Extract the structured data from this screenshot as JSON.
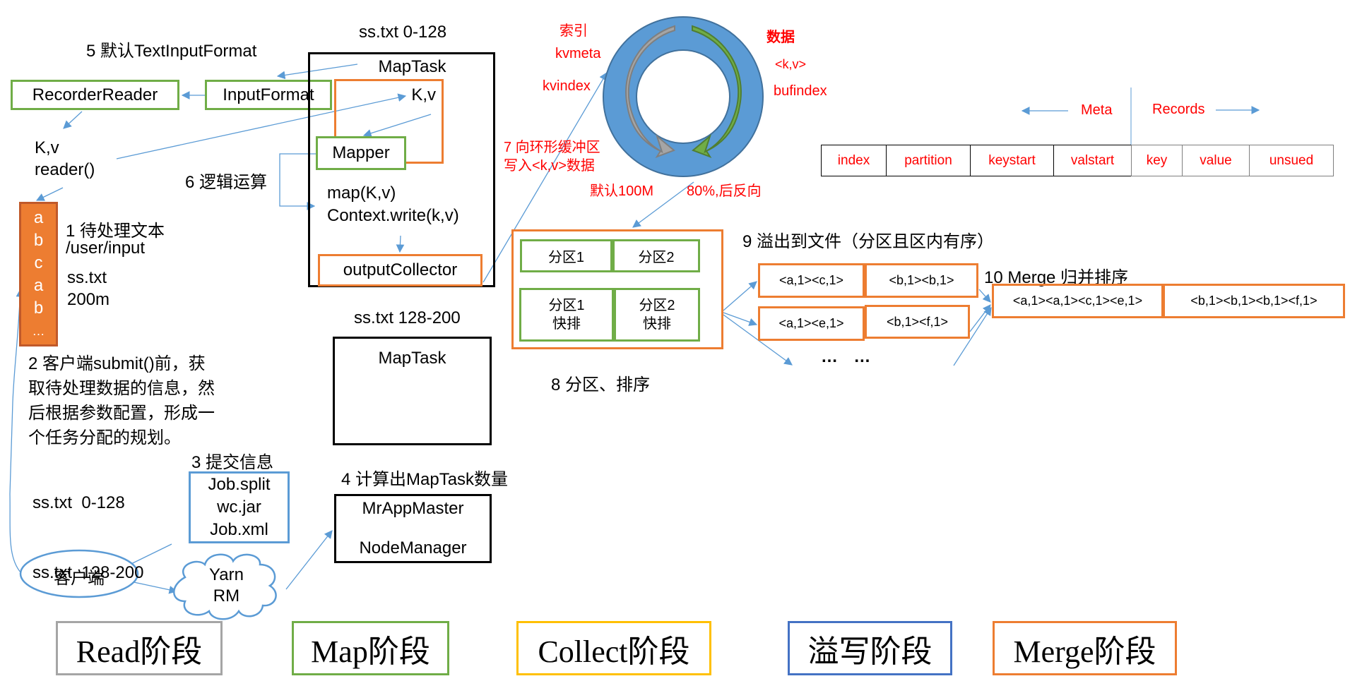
{
  "steps": {
    "s1_title": "1 待处理文本",
    "s1_path": "/user/input",
    "s1_file": "ss.txt",
    "s1_size": "200m",
    "s2_lines": [
      "2 客户端submit()前，获",
      "取待处理数据的信息，然",
      "后根据参数配置，形成一",
      "个任务分配的规划。"
    ],
    "s2_splits": [
      "ss.txt  0-128",
      "ss.txt  128-200"
    ],
    "s3_title": "3 提交信息",
    "s3_files": [
      "Job.split",
      "wc.jar",
      "Job.xml"
    ],
    "s4_title": "4 计算出MapTask数量",
    "s5_title": "5 默认TextInputFormat",
    "s6_title": "6 逻辑运算",
    "s7_lines": [
      "7 向环形缓冲区",
      "写入<k,v>数据"
    ],
    "s8_title": "8 分区、排序",
    "s9_title": "9 溢出到文件（分区且区内有序）",
    "s10_title": "10 Merge 归并排序"
  },
  "read": {
    "recorder_reader": "RecorderReader",
    "input_format": "InputFormat",
    "kv": "K,v",
    "reader_call": "reader()",
    "input_column": [
      "a",
      "b",
      "c",
      "a",
      "b",
      "…"
    ]
  },
  "maptask1": {
    "split_label": "ss.txt 0-128",
    "title": "MapTask",
    "kv": "K,v",
    "mapper": "Mapper",
    "map_call": "map(K,v)",
    "context_write": "Context.write(k,v)",
    "output_collector": "outputCollector"
  },
  "maptask2": {
    "split_label": "ss.txt 128-200",
    "title": "MapTask"
  },
  "cluster": {
    "app_master": "MrAppMaster",
    "node_manager": "NodeManager",
    "client": "客户端",
    "yarn_line1": "Yarn",
    "yarn_line2": "RM"
  },
  "ring_buffer": {
    "index_label": "索引",
    "kvmeta": "kvmeta",
    "kvindex": "kvindex",
    "data_label": "数据",
    "kv": "<k,v>",
    "bufindex": "bufindex",
    "default_size": "默认100M",
    "threshold": "80%,后反向",
    "threshold_fraction": 0.8,
    "meta_label": "Meta",
    "records_label": "Records",
    "meta_fields": [
      "index",
      "partition",
      "keystart",
      "valstart"
    ],
    "record_fields": [
      "key",
      "value",
      "unsued"
    ]
  },
  "partition": {
    "p1": "分区1",
    "p2": "分区2",
    "p1_sort": [
      "分区1",
      "快排"
    ],
    "p2_sort": [
      "分区2",
      "快排"
    ]
  },
  "spill": {
    "file1": [
      "<a,1><c,1>",
      "<b,1><b,1>"
    ],
    "file2": [
      "<a,1><e,1>",
      "<b,1><f,1>"
    ],
    "ellipsis": "…  …"
  },
  "merge": {
    "result": [
      "<a,1><a,1><c,1><e,1>",
      "<b,1><b,1><b,1><f,1>"
    ]
  },
  "phases": [
    {
      "label": "Read阶段",
      "color": "#a5a5a5"
    },
    {
      "label": "Map阶段",
      "color": "#70ad47"
    },
    {
      "label": "Collect阶段",
      "color": "#ffc000"
    },
    {
      "label": "溢写阶段",
      "color": "#4472c4"
    },
    {
      "label": "Merge阶段",
      "color": "#ed7d31"
    }
  ],
  "colors": {
    "arrow": "#5b9bd5",
    "ring": "#5b9bd5",
    "ring_border": "#41719c",
    "annotation": "#ff0000"
  }
}
